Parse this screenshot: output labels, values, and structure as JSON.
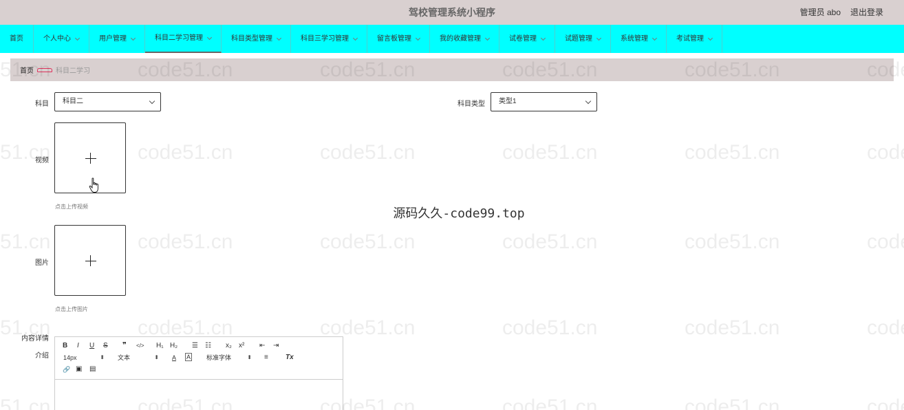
{
  "header": {
    "title": "驾校管理系统小程序",
    "user": "管理员 abo",
    "logout": "退出登录"
  },
  "nav": {
    "items": [
      {
        "label": "首页",
        "dropdown": false,
        "active": false
      },
      {
        "label": "个人中心",
        "dropdown": true,
        "active": false
      },
      {
        "label": "用户管理",
        "dropdown": true,
        "active": false
      },
      {
        "label": "科目二学习管理",
        "dropdown": true,
        "active": true
      },
      {
        "label": "科目类型管理",
        "dropdown": true,
        "active": false
      },
      {
        "label": "科目三学习管理",
        "dropdown": true,
        "active": false
      },
      {
        "label": "留言板管理",
        "dropdown": true,
        "active": false
      },
      {
        "label": "我的收藏管理",
        "dropdown": true,
        "active": false
      },
      {
        "label": "试卷管理",
        "dropdown": true,
        "active": false
      },
      {
        "label": "试题管理",
        "dropdown": true,
        "active": false
      },
      {
        "label": "系统管理",
        "dropdown": true,
        "active": false
      },
      {
        "label": "考试管理",
        "dropdown": true,
        "active": false
      }
    ]
  },
  "breadcrumb": {
    "home": "首页",
    "current": "科目二学习"
  },
  "form": {
    "subject_label": "科目",
    "subject_value": "科目二",
    "subject_type_label": "科目类型",
    "subject_type_value": "类型1",
    "video_label": "视频",
    "video_hint": "点击上传视频",
    "image_label": "图片",
    "image_hint": "点击上传图片",
    "content_label_line1": "内容详情",
    "content_label_line2": "介绍"
  },
  "editor": {
    "font_size": "14px",
    "paragraph": "文本",
    "font_family": "标准字体",
    "buttons": {
      "bold": "B",
      "italic": "I",
      "underline": "U",
      "strike": "S",
      "quote": "❞",
      "code": "</>",
      "h1": "H₁",
      "h2": "H₂",
      "ordered_list": "☰",
      "bullet_list": "☷",
      "subscript": "x₂",
      "superscript": "x²",
      "outdent": "⇤",
      "indent": "⇥",
      "color": "A",
      "background": "A",
      "align": "≡",
      "clean": "Tx",
      "link": "🔗",
      "image": "▣",
      "video": "▤"
    }
  },
  "watermarks": {
    "text": "code51.cn",
    "center": "源码久久-code99.top"
  },
  "colors": {
    "topbar": "#d9d0d0",
    "navbar": "#00ffff",
    "breadcrumb": "#d9d0d0"
  }
}
